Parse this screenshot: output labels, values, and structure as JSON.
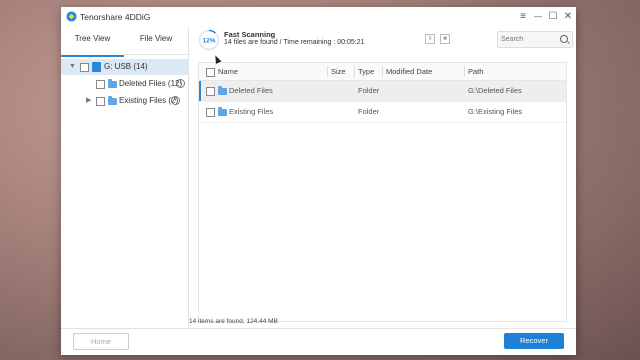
{
  "app": {
    "title": "Tenorshare 4DDiG"
  },
  "window_controls": {
    "menu": "≡",
    "minimize": "—",
    "maximize": "☐",
    "close": "✕"
  },
  "sidebar": {
    "tabs": [
      {
        "label": "Tree View"
      },
      {
        "label": "File View"
      }
    ],
    "active_tab": "Tree View",
    "tree": {
      "root": {
        "label": "G: USB (14)"
      },
      "children": [
        {
          "label": "Deleted Files (12)"
        },
        {
          "label": "Existing Files (2)"
        }
      ]
    }
  },
  "scan": {
    "progress_percent": 12,
    "progress_label": "12%",
    "title": "Fast Scanning",
    "status": "14 files are found /  Time remaining : 00:05:21"
  },
  "search": {
    "placeholder": "Search"
  },
  "table": {
    "columns": [
      "Name",
      "Size",
      "Type",
      "Modified Date",
      "Path"
    ],
    "rows": [
      {
        "name": "Deleted Files",
        "size": "",
        "type": "Folder",
        "modified": "",
        "path": "G:\\Deleted Files",
        "selected": true
      },
      {
        "name": "Existing Files",
        "size": "",
        "type": "Folder",
        "modified": "",
        "path": "G:\\Existing Files",
        "selected": false
      }
    ]
  },
  "status_bar": {
    "text": "14 items are found, 124.44 MB"
  },
  "footer": {
    "home_label": "Home",
    "recover_label": "Recover"
  },
  "colors": {
    "accent": "#1e7fd6",
    "selection": "#dde8f5"
  }
}
